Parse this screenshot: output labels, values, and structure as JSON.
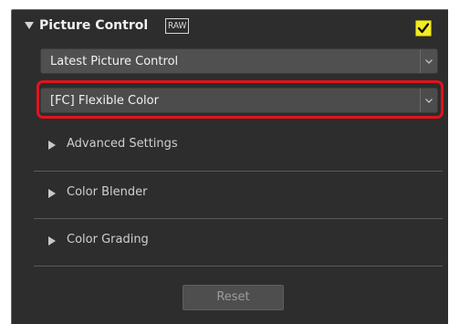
{
  "picture_control": {
    "title": "Picture Control",
    "raw_badge": "RAW",
    "enabled": true,
    "checkbox_color": "#f3ed1f",
    "highlight_color": "#e1141b"
  },
  "dropdowns": {
    "mode": {
      "selected": "Latest Picture Control"
    },
    "picture_control": {
      "selected": "[FC] Flexible Color"
    }
  },
  "sections": [
    {
      "label": "Advanced Settings"
    },
    {
      "label": "Color Blender"
    },
    {
      "label": "Color Grading"
    }
  ],
  "reset_label": "Reset"
}
